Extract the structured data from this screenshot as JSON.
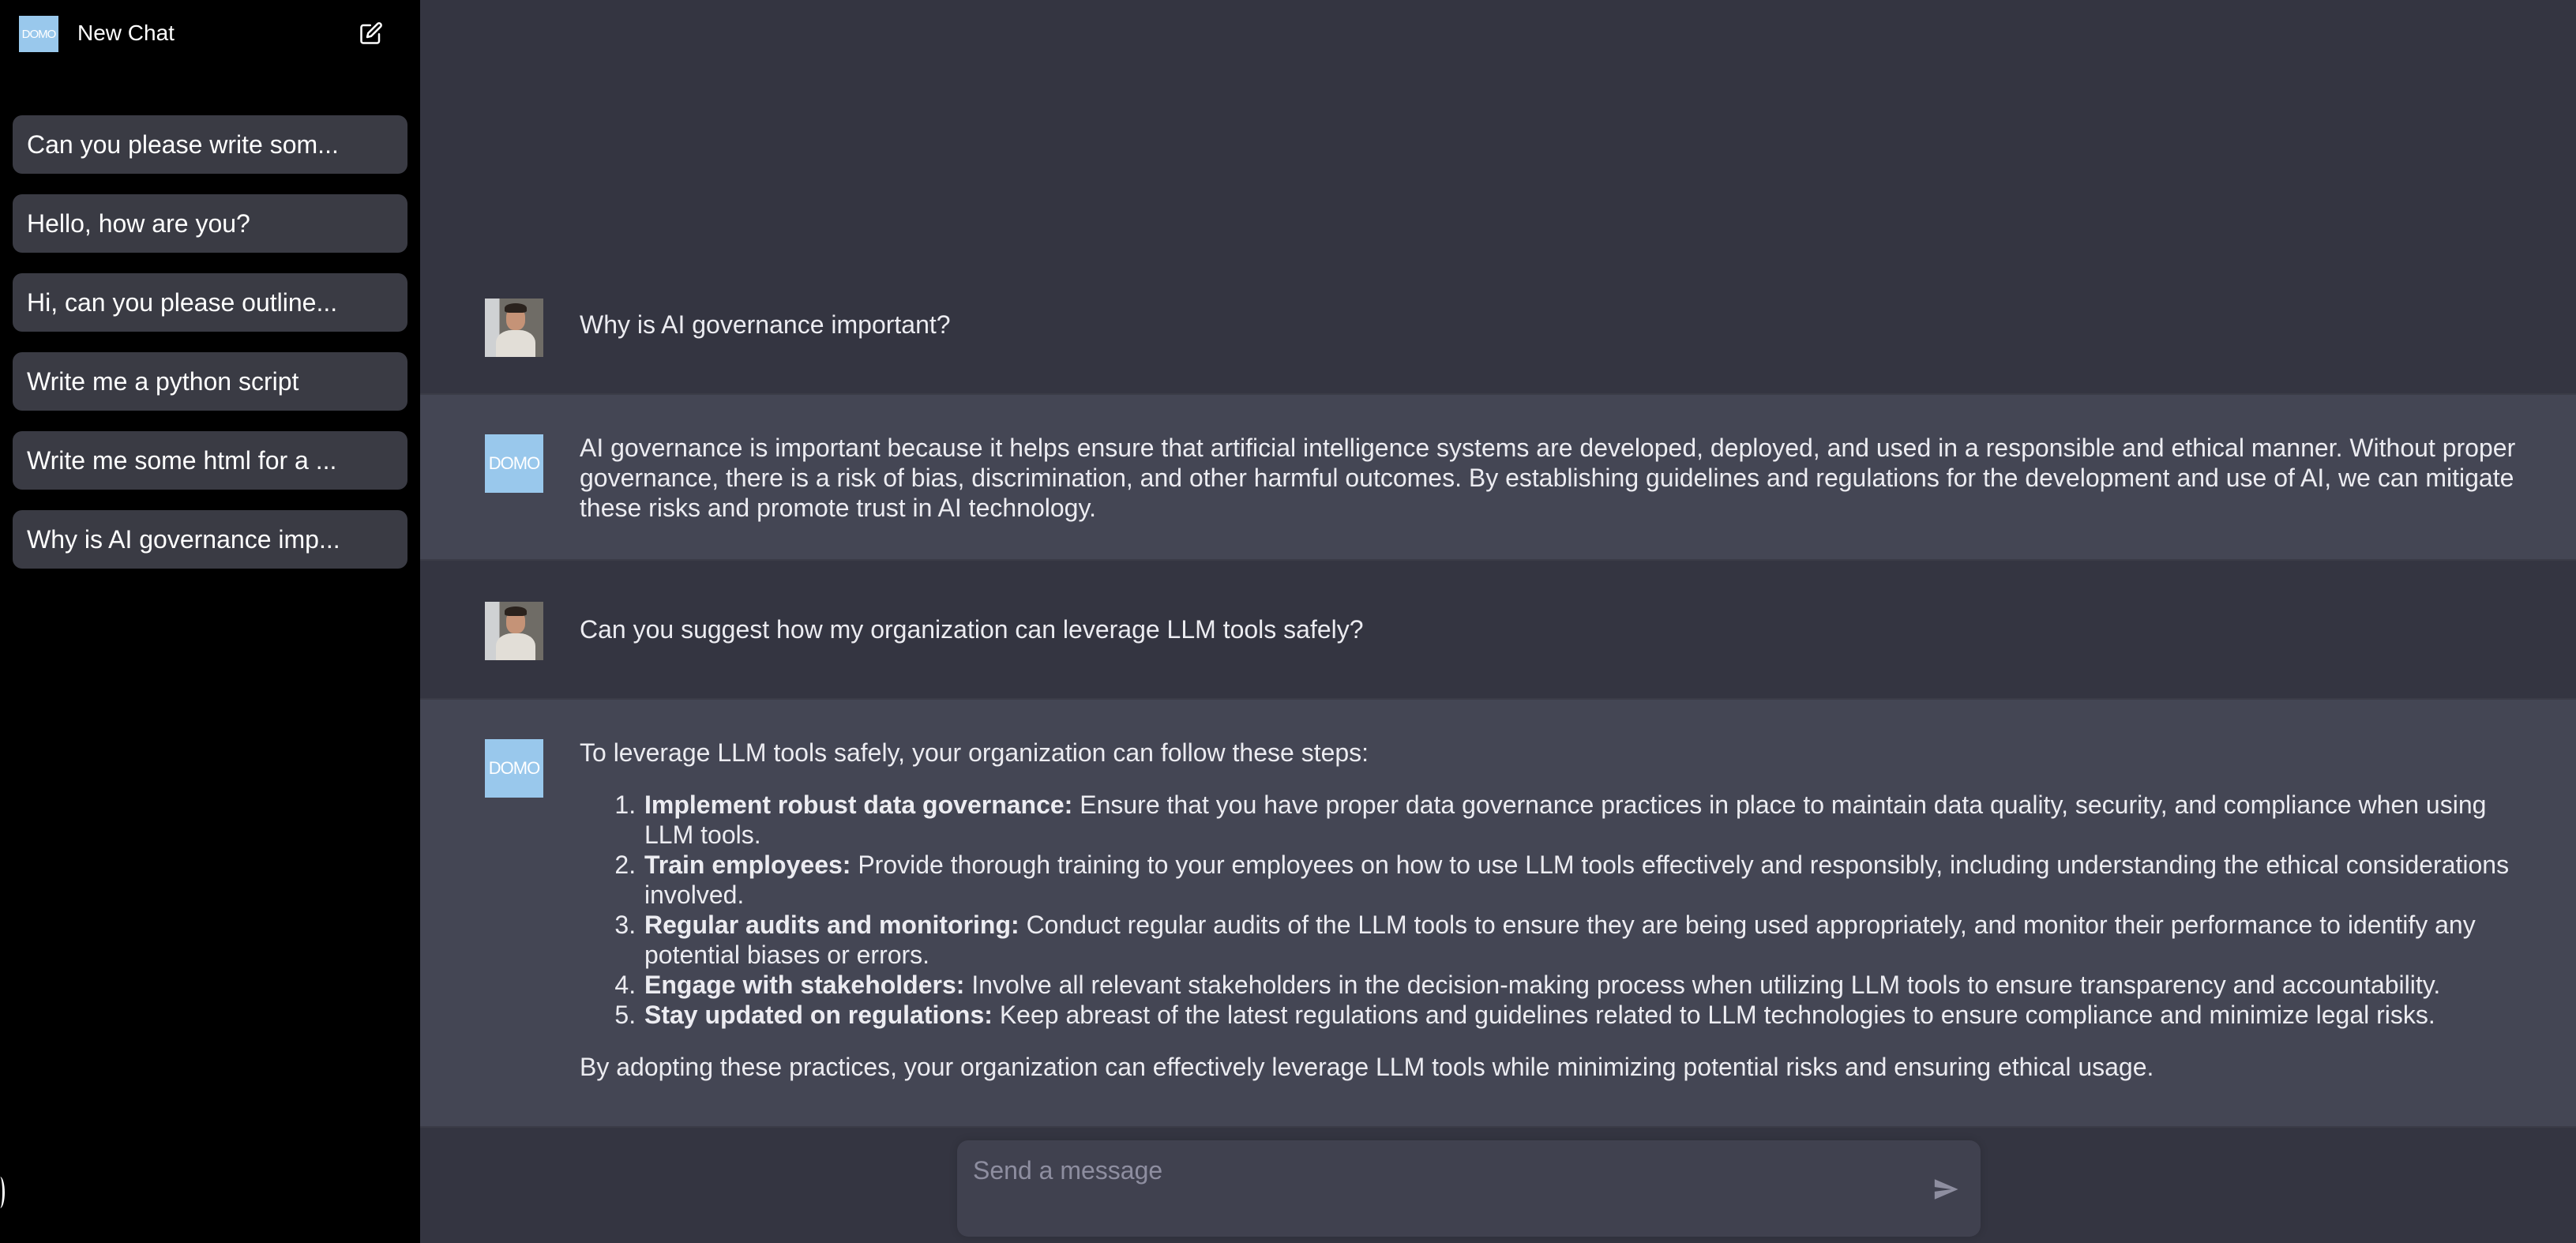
{
  "sidebar": {
    "brand_logo_text": "DOMO",
    "new_chat_label": "New Chat",
    "new_chat_icon": "edit-icon",
    "history": [
      {
        "label": "Can you please write som..."
      },
      {
        "label": "Hello, how are you?"
      },
      {
        "label": "Hi, can you please outline..."
      },
      {
        "label": "Write me a python script"
      },
      {
        "label": "Write me some html for a ..."
      },
      {
        "label": "Why is AI governance imp..."
      }
    ]
  },
  "conversation": {
    "bot_avatar_text": "DOMO",
    "messages": [
      {
        "role": "user",
        "text": "Why is AI governance important?"
      },
      {
        "role": "assistant",
        "text": "AI governance is important because it helps ensure that artificial intelligence systems are developed, deployed, and used in a responsible and ethical manner. Without proper governance, there is a risk of bias, discrimination, and other harmful outcomes. By establishing guidelines and regulations for the development and use of AI, we can mitigate these risks and promote trust in AI technology."
      },
      {
        "role": "user",
        "text": "Can you suggest how my organization can leverage LLM tools safely?"
      },
      {
        "role": "assistant",
        "intro": "To leverage LLM tools safely, your organization can follow these steps:",
        "steps": [
          {
            "title": "Implement robust data governance:",
            "text": "Ensure that you have proper data governance practices in place to maintain data quality, security, and compliance when using LLM tools."
          },
          {
            "title": "Train employees:",
            "text": "Provide thorough training to your employees on how to use LLM tools effectively and responsibly, including understanding the ethical considerations involved."
          },
          {
            "title": "Regular audits and monitoring:",
            "text": "Conduct regular audits of the LLM tools to ensure they are being used appropriately, and monitor their performance to identify any potential biases or errors."
          },
          {
            "title": "Engage with stakeholders:",
            "text": "Involve all relevant stakeholders in the decision-making process when utilizing LLM tools to ensure transparency and accountability."
          },
          {
            "title": "Stay updated on regulations:",
            "text": "Keep abreast of the latest regulations and guidelines related to LLM technologies to ensure compliance and minimize legal risks."
          }
        ],
        "outro": "By adopting these practices, your organization can effectively leverage LLM tools while minimizing potential risks and ensuring ethical usage."
      }
    ]
  },
  "composer": {
    "placeholder": "Send a message",
    "value": "",
    "send_icon": "send-icon"
  },
  "colors": {
    "sidebar_bg": "#000000",
    "main_bg": "#343541",
    "assistant_bg": "#444654",
    "history_item_bg": "#3a3b44",
    "brand_accent": "#99c8ec"
  }
}
